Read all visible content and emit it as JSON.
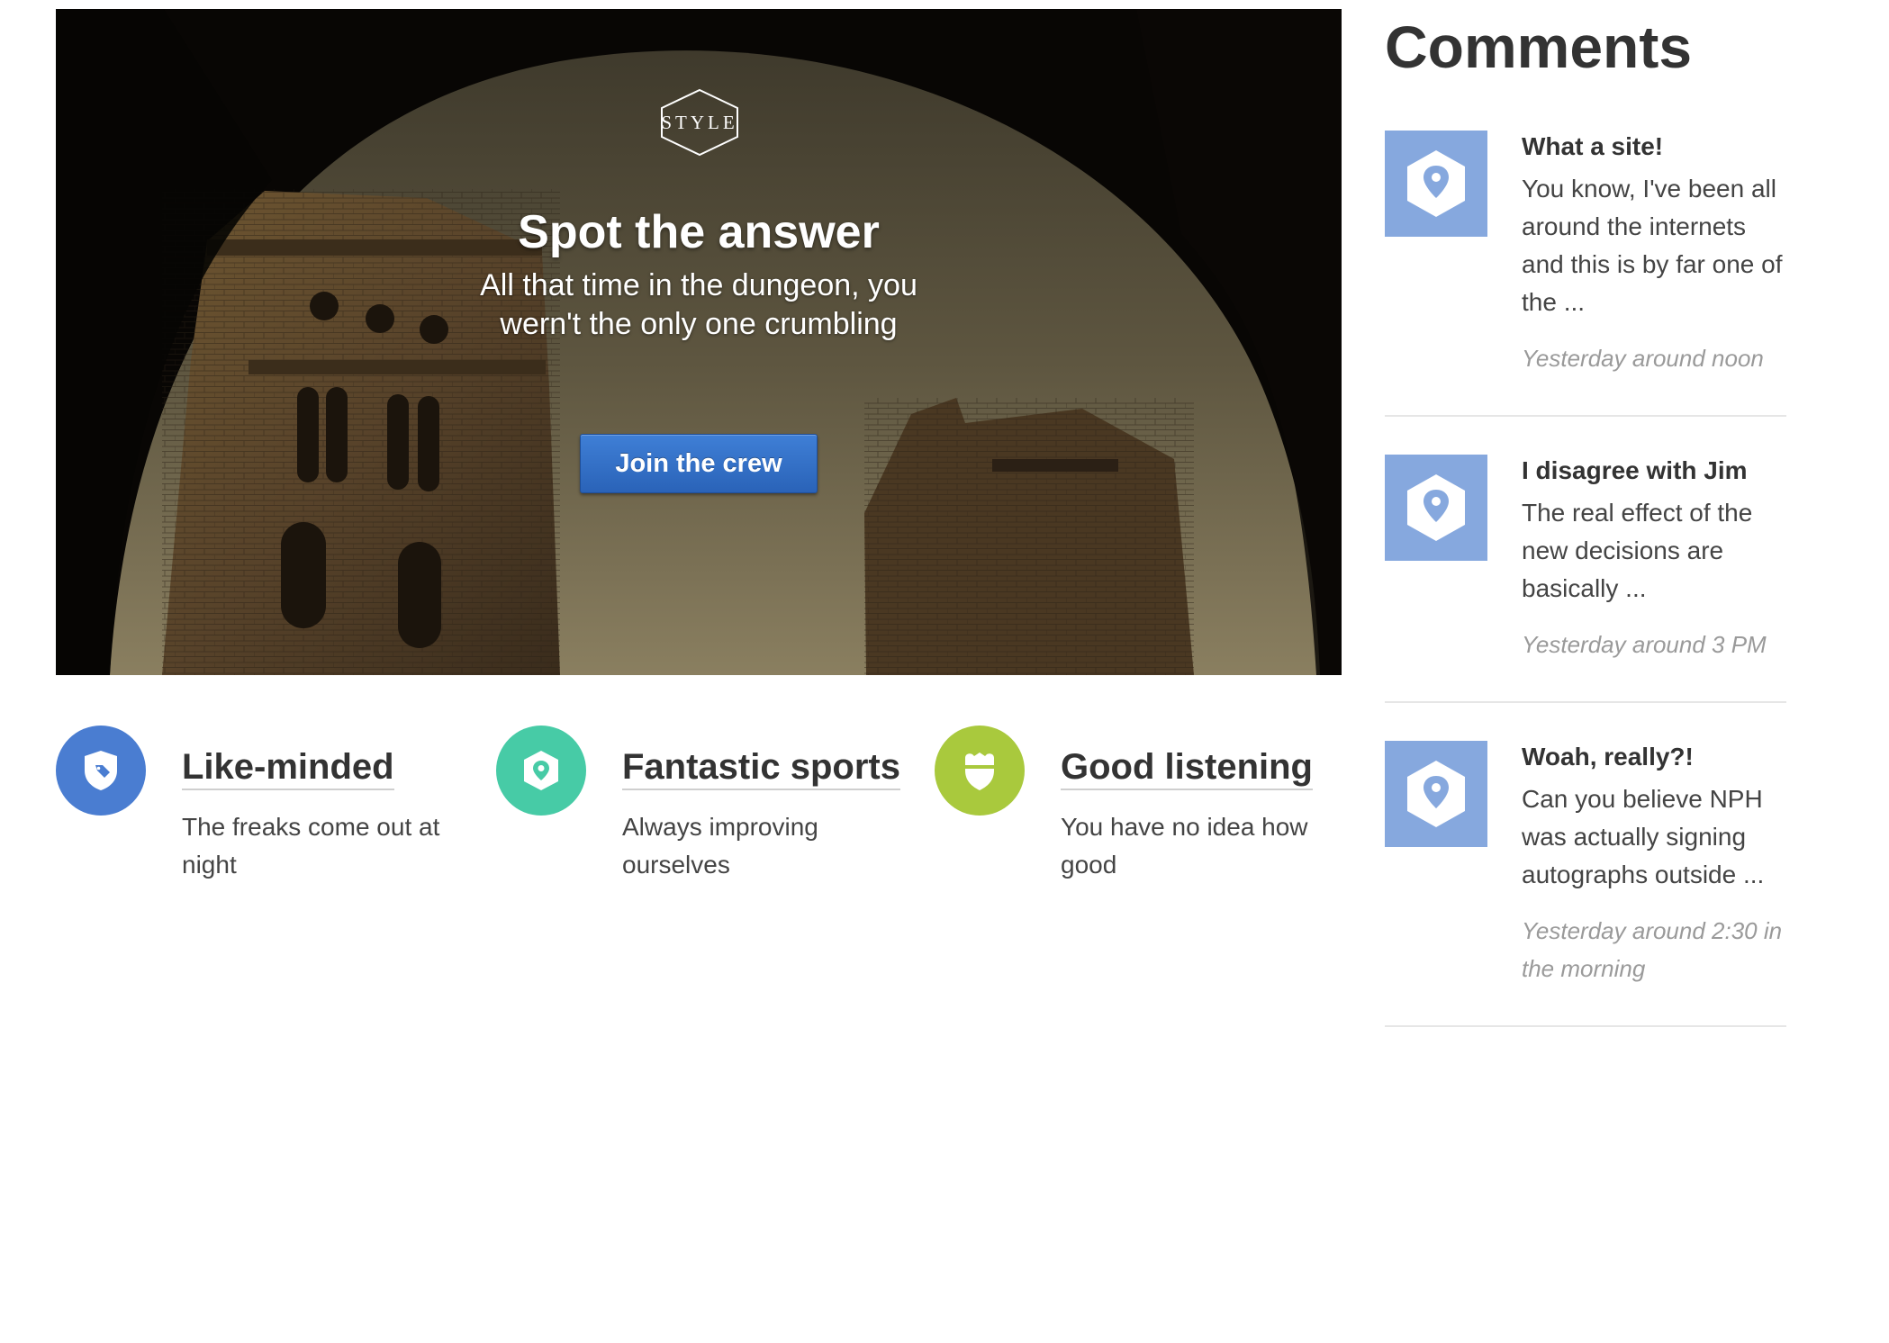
{
  "hero": {
    "logo_text": "STYLE",
    "title": "Spot the answer",
    "subtitle": "All that time in the dungeon, you wern't the only one crumbling",
    "button_label": "Join the crew"
  },
  "features": [
    {
      "title": "Like-minded",
      "text": "The freaks come out at night",
      "color": "#4a7dd1",
      "icon": "shield-tag-icon"
    },
    {
      "title": "Fantastic sports",
      "text": "Always improving ourselves",
      "color": "#47cba6",
      "icon": "map-pin-icon"
    },
    {
      "title": "Good listening",
      "text": "You have no idea how good",
      "color": "#a9c93d",
      "icon": "badge-icon"
    }
  ],
  "comments_section": {
    "heading": "Comments",
    "items": [
      {
        "title": "What a site!",
        "body": "You know, I've been all around the internets and this is by far one of the ...",
        "time": "Yesterday around noon",
        "icon": "map-pin-icon"
      },
      {
        "title": "I disagree with Jim",
        "body": "The real effect of the new decisions are basically ...",
        "time": "Yesterday around 3 PM",
        "icon": "map-pin-icon"
      },
      {
        "title": "Woah, really?!",
        "body": "Can you believe NPH was actually signing autographs outside ...",
        "time": "Yesterday around 2:30 in the morning",
        "icon": "map-pin-icon"
      }
    ]
  },
  "colors": {
    "avatar_bg": "#86a8de",
    "button_blue": "#2f6cc4"
  }
}
